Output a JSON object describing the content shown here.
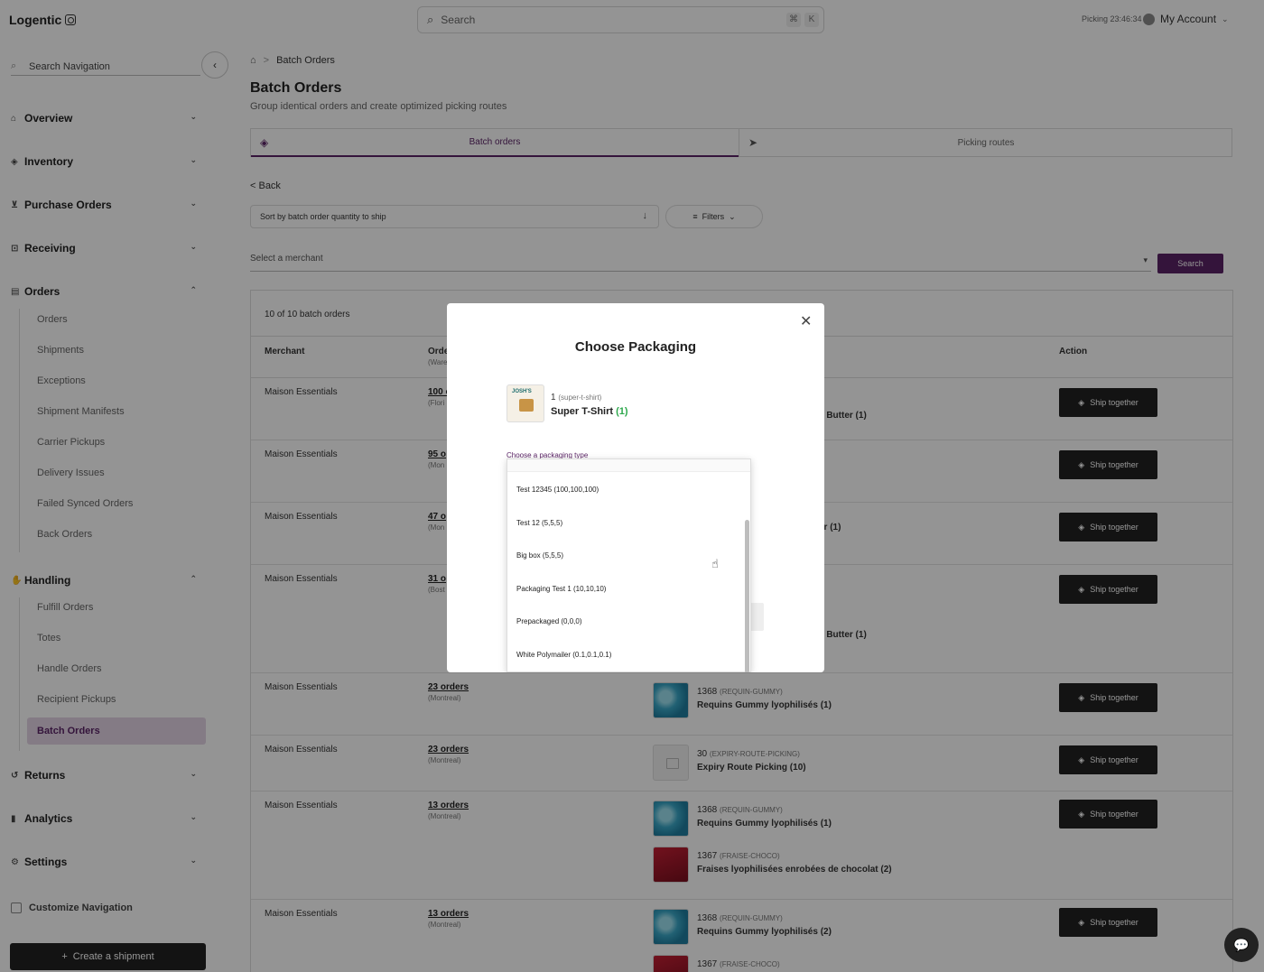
{
  "app": {
    "logo": "Logentic",
    "search_placeholder": "Search",
    "kbd_cmd": "⌘",
    "kbd_k": "K",
    "picking": "Picking 23:46:34",
    "account": "My Account"
  },
  "sidebar": {
    "search_placeholder": "Search Navigation",
    "sections": {
      "overview": "Overview",
      "inventory": "Inventory",
      "purchase_orders": "Purchase Orders",
      "receiving": "Receiving",
      "orders": "Orders",
      "handling": "Handling",
      "returns": "Returns",
      "analytics": "Analytics",
      "settings": "Settings"
    },
    "orders_items": [
      "Orders",
      "Shipments",
      "Exceptions",
      "Shipment Manifests",
      "Carrier Pickups",
      "Delivery Issues",
      "Failed Synced Orders",
      "Back Orders"
    ],
    "handling_items": [
      "Fulfill Orders",
      "Totes",
      "Handle Orders",
      "Recipient Pickups",
      "Batch Orders"
    ],
    "customize": "Customize Navigation",
    "create_button": "Create a shipment"
  },
  "page": {
    "breadcrumb_current": "Batch Orders",
    "title": "Batch Orders",
    "subtitle": "Group identical orders and create optimized picking routes",
    "tabs": [
      "Batch orders",
      "Picking routes"
    ],
    "back": "< Back",
    "sort_label": "Sort by batch order quantity to ship",
    "filters_label": "Filters",
    "merchant_placeholder": "Select a merchant",
    "search_button": "Search"
  },
  "table": {
    "count": "10 of 10 batch orders",
    "headers": {
      "merchant": "Merchant",
      "orders": "Orde",
      "orders_sub": "(Ware",
      "action": "Action"
    },
    "ship_label": "Ship together",
    "rows": [
      {
        "merchant": "Maison Essentials",
        "orders": "100 o",
        "city": "(Flori",
        "product_partial": "a Butter (1)"
      },
      {
        "merchant": "Maison Essentials",
        "orders": "95 o",
        "city": "(Mon"
      },
      {
        "merchant": "Maison Essentials",
        "orders": "47 o",
        "city": "(Mon",
        "product_partial": "er (1)"
      },
      {
        "merchant": "Maison Essentials",
        "orders": "31 o",
        "city": "(Bost",
        "product_partial": "a Butter (1)"
      },
      {
        "merchant": "Maison Essentials",
        "orders": "23 orders",
        "city": "(Montreal)",
        "products": [
          {
            "sku": "1368",
            "code": "(REQUIN-GUMMY)",
            "name": "Requins Gummy lyophilisés (1)"
          }
        ]
      },
      {
        "merchant": "Maison Essentials",
        "orders": "23 orders",
        "city": "(Montreal)",
        "products": [
          {
            "sku": "30",
            "code": "(EXPIRY-ROUTE-PICKING)",
            "name": "Expiry Route Picking (10)"
          }
        ]
      },
      {
        "merchant": "Maison Essentials",
        "orders": "13 orders",
        "city": "(Montreal)",
        "products": [
          {
            "sku": "1368",
            "code": "(REQUIN-GUMMY)",
            "name": "Requins Gummy lyophilisés (1)"
          },
          {
            "sku": "1367",
            "code": "(FRAISE-CHOCO)",
            "name": "Fraises lyophilisées enrobées de chocolat (2)"
          }
        ]
      },
      {
        "merchant": "Maison Essentials",
        "orders": "13 orders",
        "city": "(Montreal)",
        "products": [
          {
            "sku": "1368",
            "code": "(REQUIN-GUMMY)",
            "name": "Requins Gummy lyophilisés (2)"
          },
          {
            "sku": "1367",
            "code": "(FRAISE-CHOCO)",
            "name": ""
          }
        ]
      }
    ]
  },
  "modal": {
    "title": "Choose Packaging",
    "item_qty": "1",
    "item_code": "(super-t-shirt)",
    "item_name": "Super T-Shirt",
    "item_count": "(1)",
    "thumb_text": "JOSH'S",
    "packaging_label": "Choose a packaging type",
    "options": [
      "Test 12345 (100,100,100)",
      "Test 12 (5,5,5)",
      "Big box (5,5,5)",
      "Packaging Test 1 (10,10,10)",
      "Prepackaged (0,0,0)",
      "White Polymailer (0.1,0.1,0.1)"
    ]
  },
  "icons": {
    "home": "home-icon",
    "close": "close-icon",
    "chat": "chat-icon"
  },
  "colors": {
    "accent": "#5b2466",
    "active_nav": "#e3d5e6",
    "dark_button": "#222222",
    "count_green": "#2ea84d"
  }
}
